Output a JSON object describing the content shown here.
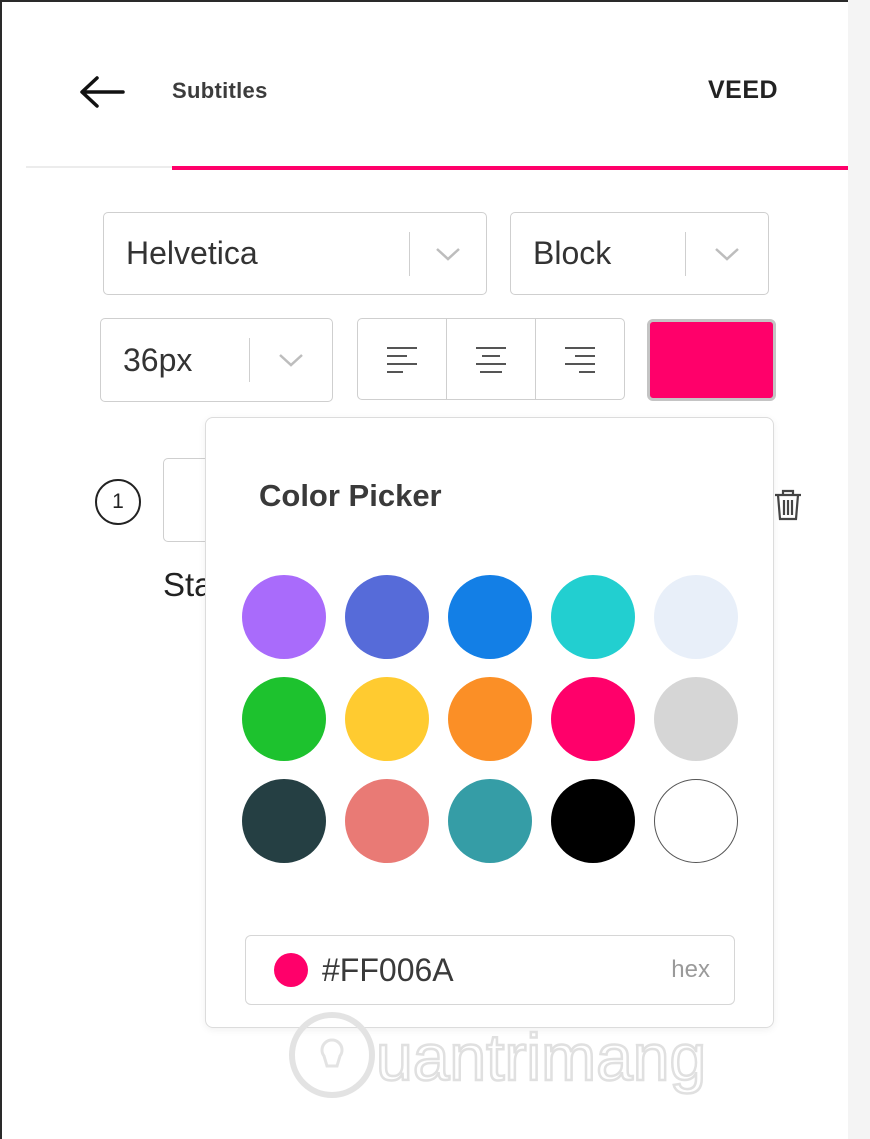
{
  "header": {
    "back_icon": "arrow-left-icon",
    "title": "Subtitles",
    "brand": "VEED",
    "accent_color": "#ff006a"
  },
  "controls": {
    "font": {
      "value": "Helvetica"
    },
    "style": {
      "value": "Block"
    },
    "size": {
      "value": "36px"
    },
    "alignments": [
      "align-left-icon",
      "align-center-icon",
      "align-right-icon"
    ],
    "current_color": "#FF006A"
  },
  "subtitle_row": {
    "index": "1",
    "text": "Sta",
    "delete_icon": "trash-icon"
  },
  "color_picker": {
    "title": "Color Picker",
    "swatches": [
      "#a96bfb",
      "#566bd9",
      "#137fe6",
      "#22cfd0",
      "#e8eff9",
      "#1dc22e",
      "#ffcb30",
      "#fb8f26",
      "#ff006a",
      "#d6d6d6",
      "#253f43",
      "#e97a75",
      "#359da6",
      "#000000",
      "#ffffff"
    ],
    "hex_value": "#FF006A",
    "hex_mode": "hex"
  },
  "watermark": {
    "text": "uantrimang"
  }
}
